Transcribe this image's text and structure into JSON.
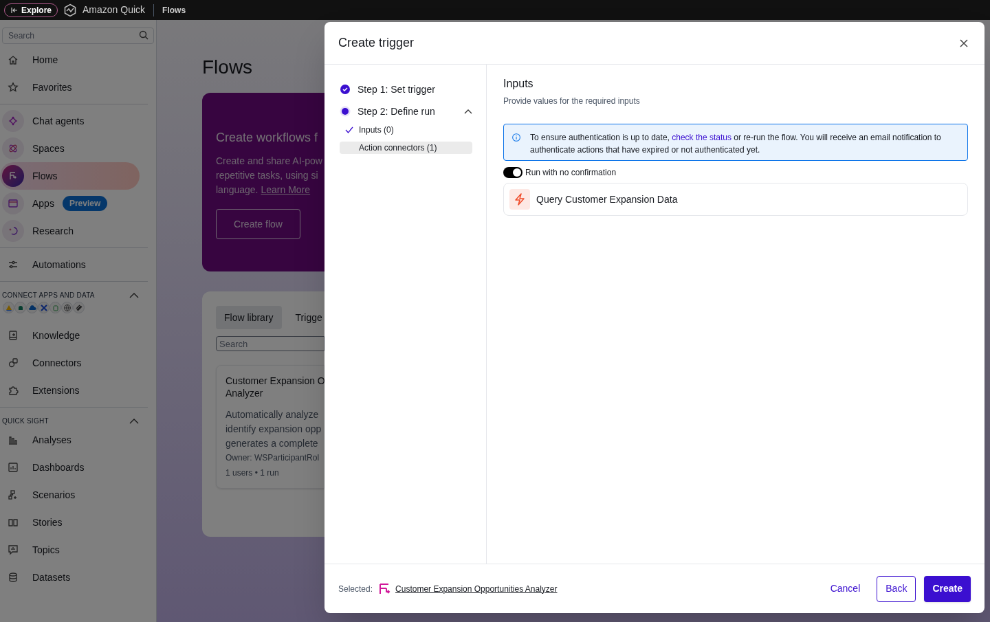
{
  "top_bar": {
    "explore_button": "Explore",
    "app_name": "Amazon Quick",
    "breadcrumb": "Flows"
  },
  "sidebar": {
    "search": {
      "placeholder": "Search"
    },
    "groups": [
      {
        "items": [
          {
            "label": "Home",
            "kind": "plain",
            "selected": false
          },
          {
            "label": "Favorites",
            "kind": "plain",
            "selected": false
          }
        ]
      },
      {
        "items": [
          {
            "label": "Chat agents",
            "kind": "badge",
            "selected": false
          },
          {
            "label": "Spaces",
            "kind": "badge",
            "selected": false
          },
          {
            "label": "Flows",
            "kind": "badge",
            "selected": true
          },
          {
            "label": "Apps",
            "kind": "badge",
            "selected": false,
            "badge": "Preview"
          },
          {
            "label": "Research",
            "kind": "badge",
            "selected": false
          }
        ]
      },
      {
        "items": [
          {
            "label": "Automations",
            "kind": "plain",
            "selected": false
          }
        ]
      },
      {
        "heading": "CONNECT APPS AND DATA",
        "expanded": true,
        "app_icons": true,
        "items": [
          {
            "label": "Knowledge",
            "kind": "plain",
            "selected": false
          },
          {
            "label": "Connectors",
            "kind": "plain",
            "selected": false
          },
          {
            "label": "Extensions",
            "kind": "plain",
            "selected": false
          }
        ]
      },
      {
        "heading": "QUICK SIGHT",
        "expanded": true,
        "items": [
          {
            "label": "Analyses",
            "kind": "plain",
            "selected": false
          },
          {
            "label": "Dashboards",
            "kind": "plain",
            "selected": false
          },
          {
            "label": "Scenarios",
            "kind": "plain",
            "selected": false
          },
          {
            "label": "Stories",
            "kind": "plain",
            "selected": false
          },
          {
            "label": "Topics",
            "kind": "plain",
            "selected": false
          },
          {
            "label": "Datasets",
            "kind": "plain",
            "selected": false
          }
        ]
      }
    ]
  },
  "main": {
    "page_title": "Flows",
    "hero": {
      "title": "Create workflows f",
      "lines": [
        "Create and share AI-pow",
        "repetitive tasks, using si"
      ],
      "last_line": "language.",
      "link": "Learn More",
      "button": "Create flow"
    },
    "library": {
      "tabs": [
        {
          "label": "Flow library",
          "selected": true
        },
        {
          "label": "Trigge",
          "selected": false
        }
      ],
      "search": {
        "placeholder": "Search"
      },
      "card": {
        "title_lines": [
          "Customer Expansion O",
          "Analyzer"
        ],
        "description_lines": [
          "Automatically analyze",
          "identify expansion opp",
          "generates a complete"
        ],
        "owner": "Owner: WSParticipantRol",
        "meta": "1 users • 1 run"
      }
    }
  },
  "dialog": {
    "title": "Create trigger",
    "steps": [
      {
        "label": "Step 1: Set trigger",
        "done": true,
        "current": false
      },
      {
        "label": "Step 2: Define run",
        "done": false,
        "current": true,
        "expanded": true,
        "children": [
          {
            "label": "Inputs (0)",
            "checked": true,
            "selected": false
          },
          {
            "label": "Action connectors (1)",
            "checked": false,
            "selected": true
          }
        ]
      }
    ],
    "heading": "Inputs",
    "description": "Provide values for the required inputs",
    "alert": {
      "text_before": "To ensure authentication is up to date, ",
      "link": "check the status",
      "text_after": " or re-run the flow. You will receive an email notification to authenticate actions that have expired or not authenticated yet."
    },
    "toggle": {
      "label": "Run with no confirmation",
      "on": true
    },
    "action": {
      "title": "Query Customer Expansion Data"
    },
    "footer": {
      "selected_label": "Selected:",
      "selected_flow": "Customer Expansion Opportunities Analyzer",
      "buttons": [
        {
          "label": "Cancel",
          "kind": "link"
        },
        {
          "label": "Back",
          "kind": "secondary"
        },
        {
          "label": "Create",
          "kind": "primary"
        }
      ]
    }
  }
}
